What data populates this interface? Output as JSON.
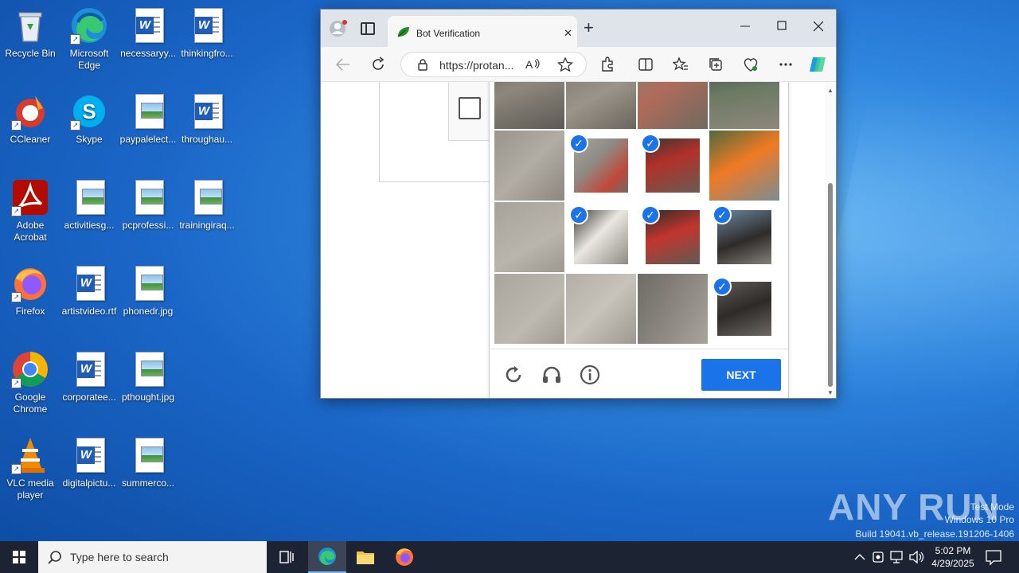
{
  "desktop": {
    "icons": [
      {
        "label": "Recycle Bin"
      },
      {
        "label": "Microsoft Edge"
      },
      {
        "label": "necessaryy..."
      },
      {
        "label": "thinkingfro..."
      },
      {
        "label": "CCleaner"
      },
      {
        "label": "Skype"
      },
      {
        "label": "paypalelect..."
      },
      {
        "label": "throughau..."
      },
      {
        "label": "Adobe Acrobat"
      },
      {
        "label": "activitiesg..."
      },
      {
        "label": "pcprofessi..."
      },
      {
        "label": "trainingiraq..."
      },
      {
        "label": "Firefox"
      },
      {
        "label": "artistvideo.rtf"
      },
      {
        "label": "phonedr.jpg"
      },
      {
        "label": "Google Chrome"
      },
      {
        "label": "corporatee..."
      },
      {
        "label": "pthought.jpg"
      },
      {
        "label": "VLC media player"
      },
      {
        "label": "digitalpictu..."
      },
      {
        "label": "summerco..."
      }
    ]
  },
  "browser": {
    "tab_title": "Bot Verification",
    "url": "https://protan...",
    "close_tab_symbol": "✕",
    "new_tab_symbol": "+"
  },
  "captcha": {
    "next_label": "NEXT",
    "grid": [
      {
        "row": 0,
        "col": 0,
        "selected": false
      },
      {
        "row": 0,
        "col": 1,
        "selected": false
      },
      {
        "row": 0,
        "col": 2,
        "selected": false
      },
      {
        "row": 0,
        "col": 3,
        "selected": false
      },
      {
        "row": 1,
        "col": 0,
        "selected": false
      },
      {
        "row": 1,
        "col": 1,
        "selected": true
      },
      {
        "row": 1,
        "col": 2,
        "selected": true
      },
      {
        "row": 1,
        "col": 3,
        "selected": false
      },
      {
        "row": 2,
        "col": 0,
        "selected": false
      },
      {
        "row": 2,
        "col": 1,
        "selected": true
      },
      {
        "row": 2,
        "col": 2,
        "selected": true
      },
      {
        "row": 2,
        "col": 3,
        "selected": true
      },
      {
        "row": 3,
        "col": 0,
        "selected": false
      },
      {
        "row": 3,
        "col": 1,
        "selected": false
      },
      {
        "row": 3,
        "col": 2,
        "selected": false
      },
      {
        "row": 3,
        "col": 3,
        "selected": true
      }
    ]
  },
  "taskbar": {
    "search_placeholder": "Type here to search",
    "time": "5:02 PM",
    "date": "4/29/2025"
  },
  "watermark": {
    "brand": "ANY RUN",
    "line1": "Test Mode",
    "line2": "Windows 10 Pro",
    "line3": "Build 19041.vb_release.191206-1406"
  }
}
